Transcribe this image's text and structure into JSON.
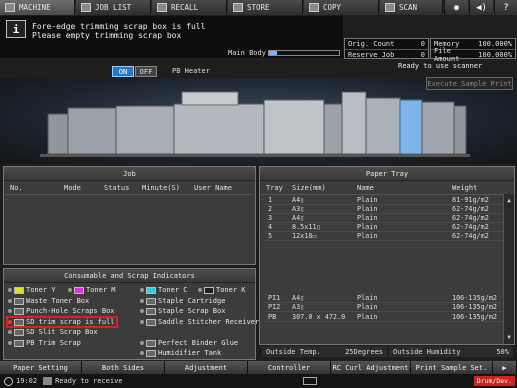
{
  "tabs": [
    {
      "label": "MACHINE",
      "icon": "machine-icon"
    },
    {
      "label": "JOB LIST",
      "icon": "job-list-icon"
    },
    {
      "label": "RECALL",
      "icon": "recall-icon"
    },
    {
      "label": "STORE",
      "icon": "store-icon"
    },
    {
      "label": "COPY",
      "icon": "copy-icon"
    },
    {
      "label": "SCAN",
      "icon": "scan-icon"
    }
  ],
  "message": {
    "line1": "Fore-edge trimming scrap box is full",
    "line2": "Please empty trimming scrap box"
  },
  "main_body": {
    "label": "Main Body",
    "level": 0.1
  },
  "counters": {
    "orig_count_label": "Orig. Count",
    "orig_count": "0",
    "reserve_job_label": "Reserve Job",
    "reserve_job": "0",
    "memory_label": "Memory",
    "memory": "100.000%",
    "file_amount_label": "File Amount",
    "file_amount": "100.000%"
  },
  "status_text": "Ready to use scanner",
  "execute_sample_print": "Execute Sample Print",
  "pb_heater": {
    "on": "ON",
    "off": "OFF",
    "label": "PB Heater"
  },
  "job": {
    "title": "Job",
    "columns": [
      "No.",
      "Mode",
      "Status",
      "Minute(S)",
      "User Name"
    ]
  },
  "paper_tray": {
    "title": "Paper Tray",
    "columns": [
      "Tray",
      "Size(mm)",
      "Name",
      "Weight"
    ],
    "rows": [
      {
        "tray": "1",
        "size": "A4▯",
        "name": "Plain",
        "weight": "81-91g/m2"
      },
      {
        "tray": "2",
        "size": "A3▯",
        "name": "Plain",
        "weight": "62-74g/m2"
      },
      {
        "tray": "3",
        "size": "A4▯",
        "name": "Plain",
        "weight": "62-74g/m2"
      },
      {
        "tray": "4",
        "size": "8.5x11▯",
        "name": "Plain",
        "weight": "62-74g/m2"
      },
      {
        "tray": "5",
        "size": "12x18▭",
        "name": "Plain",
        "weight": "62-74g/m2"
      },
      {
        "tray": "PI1",
        "size": "A4▯",
        "name": "Plain",
        "weight": "106-135g/m2"
      },
      {
        "tray": "PI2",
        "size": "A3▯",
        "name": "Plain",
        "weight": "106-135g/m2"
      },
      {
        "tray": "PB",
        "size": "307.0 x 472.0",
        "name": "Plain",
        "weight": "106-135g/m2"
      }
    ],
    "outside_temp_label": "Outside Temp.",
    "outside_temp": "25Degrees",
    "outside_humidity_label": "Outside Humidity",
    "outside_humidity": "50%"
  },
  "consumables": {
    "title": "Consumable and Scrap Indicators",
    "items": [
      {
        "label": "Toner Y"
      },
      {
        "label": "Toner M"
      },
      {
        "label": "Toner C"
      },
      {
        "label": "Toner K"
      },
      {
        "label": "Waste Toner Box"
      },
      {
        "label": "Staple Cartridge"
      },
      {
        "label": "Punch-Hole Scraps Box"
      },
      {
        "label": "Staple Scrap Box"
      },
      {
        "label": "SD trim scrap is full"
      },
      {
        "label": "Saddle Stitcher Receiver"
      },
      {
        "label": "SD Slit Scrap Box"
      },
      {
        "label": "PB Trim Scrap"
      },
      {
        "label": "Perfect Binder Glue"
      },
      {
        "label": "Humidifier Tank"
      }
    ]
  },
  "bottom_buttons": [
    "Paper Setting",
    "Both Sides",
    "Adjustment",
    "Controller",
    "RC Curl Adjustment",
    "Print Sample Set."
  ],
  "statusbar": {
    "time": "19:02",
    "text": "Ready to receive",
    "drum": "Drum/Dev."
  }
}
